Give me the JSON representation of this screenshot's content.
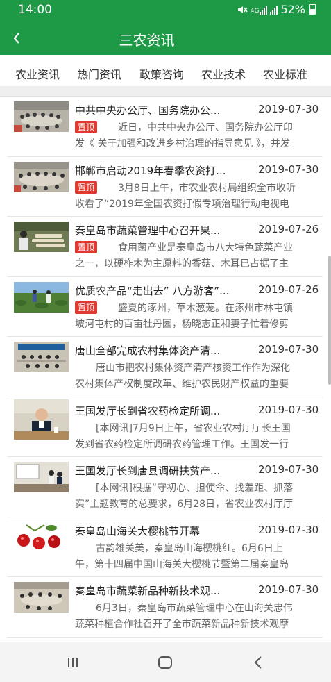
{
  "status_bar": {
    "time": "14:00",
    "network": "4G",
    "battery": "52%",
    "icons": [
      "mute-icon",
      "signal-4g-icon",
      "signal-icon",
      "battery-icon"
    ]
  },
  "header": {
    "back_icon": "chevron-left-icon",
    "title": "三农资讯"
  },
  "tabs": [
    {
      "label": "农业资讯"
    },
    {
      "label": "热门资讯"
    },
    {
      "label": "政策咨询"
    },
    {
      "label": "农业技术"
    },
    {
      "label": "农业标准"
    }
  ],
  "pin_label": "置顶",
  "news": [
    {
      "title": "中共中央办公厅、国务院办公...",
      "date": "2019-07-30",
      "pinned": true,
      "line1": "近日，中共中央办公厅、国务院办公厅印",
      "line2": "发《 关于加强和改进乡村治理的指导意见 》，并发",
      "thumb": "meeting"
    },
    {
      "title": "邯郸市启动2019年春季农资打...",
      "date": "2019-07-30",
      "pinned": true,
      "line1": "3月8日上午，市农业农村局组织全市收听",
      "line2": "收看了“2019年全国农资打假专项治理行动电视电",
      "thumb": "meeting"
    },
    {
      "title": "秦皇岛市蔬菜管理中心召开果...",
      "date": "2019-07-26",
      "pinned": true,
      "line1": "食用菌产业是秦皇岛市八大特色蔬菜产业",
      "line2": "之一，以硬柞木为主原料的香菇、木耳已占据了主",
      "thumb": "logs"
    },
    {
      "title": "优质农产品“走出去” 八方游客”...",
      "date": "2019-07-26",
      "pinned": true,
      "line1": "盛夏的涿州，草木葱茏。在涿州市林屯镇",
      "line2": "坡河屯村的百亩牡丹园，杨晓志正和妻子忙着修剪",
      "thumb": "field"
    },
    {
      "title": "唐山全部完成农村集体资产清...",
      "date": "2019-07-30",
      "pinned": false,
      "line1": "唐山市把农村集体资产清产核资工作作为深化",
      "line2": "农村集体产权制度改革、维护农民财产权益的重要",
      "thumb": "conference"
    },
    {
      "title": "王国发厅长到省农药检定所调...",
      "date": "2019-07-30",
      "pinned": false,
      "line1": "[本网讯]7月9日上午，省农业农村厅厅长王国",
      "line2": "发到省农药检定所调研农药管理工作。王国发一行",
      "thumb": "speaker"
    },
    {
      "title": "王国发厅长到唐县调研扶贫产...",
      "date": "2019-07-30",
      "pinned": false,
      "line1": "[本网讯]根据“守初心、担使命、找差距、抓落",
      "line2": "实”主题教育的总要求，6月28日，省农业农村厅厅",
      "thumb": "office"
    },
    {
      "title": "秦皇岛山海关大樱桃节开幕",
      "date": "2019-07-30",
      "pinned": false,
      "line1": "古韵雄关美，秦皇岛山海樱桃红。6月6日上",
      "line2": "午，第十四届中国山海关大樱桃节暨第二届秦皇岛",
      "thumb": "cherries"
    },
    {
      "title": "秦皇岛市蔬菜新品种新技术观...",
      "date": "2019-07-30",
      "pinned": false,
      "line1": "6月3日，秦皇岛市蔬菜管理中心在山海关忠伟",
      "line2": "蔬菜种植合作社召开了全市蔬菜新品种新技术观摩",
      "thumb": "meeting2"
    }
  ],
  "navbar": {
    "recent_icon": "recent-apps-icon",
    "home_icon": "home-icon",
    "back_icon": "back-icon"
  },
  "colors": {
    "header": "#1e9a47",
    "pin_badge": "#e0392f"
  }
}
